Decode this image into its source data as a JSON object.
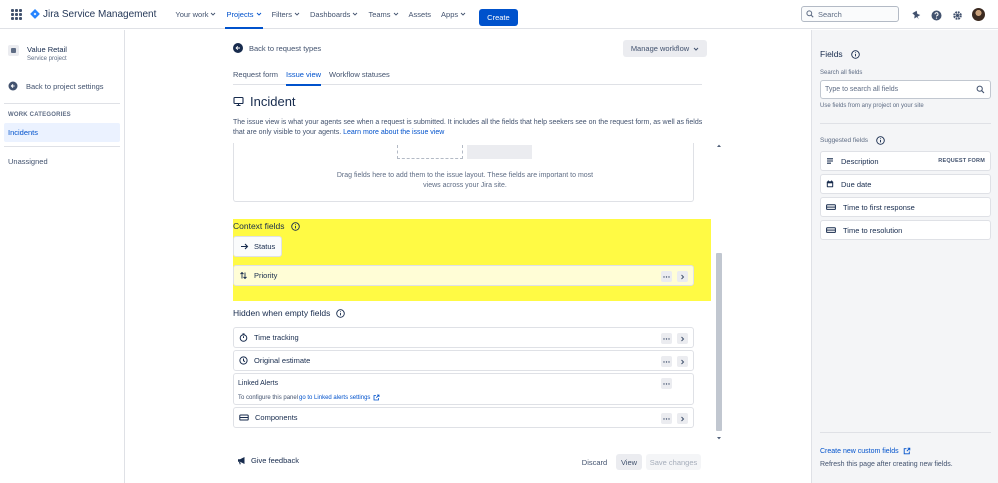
{
  "topnav": {
    "logo_text": "Jira Service Management",
    "items": [
      {
        "label": "Your work",
        "has_menu": true
      },
      {
        "label": "Projects",
        "has_menu": true,
        "active": true
      },
      {
        "label": "Filters",
        "has_menu": true
      },
      {
        "label": "Dashboards",
        "has_menu": true
      },
      {
        "label": "Teams",
        "has_menu": true
      },
      {
        "label": "Assets",
        "has_menu": false
      },
      {
        "label": "Apps",
        "has_menu": true
      }
    ],
    "create_label": "Create",
    "search_placeholder": "Search",
    "icons": [
      "notification-icon",
      "help-icon",
      "settings-icon",
      "avatar"
    ]
  },
  "sidebar": {
    "project_name": "Value Retail",
    "project_type": "Service project",
    "back_label": "Back to project settings",
    "heading": "WORK CATEGORIES",
    "items": [
      {
        "label": "Incidents",
        "active": true
      },
      {
        "label": "Unassigned",
        "active": false
      }
    ]
  },
  "main": {
    "back_label": "Back to request types",
    "manage_workflow_label": "Manage workflow",
    "tabs": [
      {
        "label": "Request form",
        "active": false
      },
      {
        "label": "Issue view",
        "active": true
      },
      {
        "label": "Workflow statuses",
        "active": false
      }
    ],
    "title": "Incident",
    "description": "The issue view is what your agents see when a request is submitted. It includes all the fields that help seekers see on the request form, as well as fields that are only visible to your agents.",
    "learn_more_label": "Learn more about the issue view",
    "dropzone_text": "Drag fields here to add them to the issue layout. These fields are important to most views across your Jira site.",
    "context": {
      "title": "Context fields",
      "status_label": "Status",
      "priority_label": "Priority"
    },
    "hidden": {
      "title": "Hidden when empty fields",
      "rows": [
        {
          "label": "Time tracking",
          "icon": "stopwatch-icon"
        },
        {
          "label": "Original estimate",
          "icon": "clock-icon"
        }
      ],
      "linked_alerts": {
        "title": "Linked Alerts",
        "prefix": "To configure this panel",
        "link": "go to Linked alerts settings"
      },
      "components_label": "Components"
    },
    "footer": {
      "feedback_label": "Give feedback",
      "discard_label": "Discard",
      "view_label": "View",
      "save_label": "Save changes"
    },
    "highlight_color": "#fffa44"
  },
  "fields_panel": {
    "title": "Fields",
    "search_label": "Search all fields",
    "search_placeholder": "Type to search all fields",
    "search_hint": "Use fields from any project on your site",
    "suggested_label": "Suggested fields",
    "suggested": [
      {
        "label": "Description",
        "badge": "REQUEST FORM",
        "icon": "text-lines-icon"
      },
      {
        "label": "Due date",
        "badge": "",
        "icon": "calendar-icon"
      },
      {
        "label": "Time to first response",
        "badge": "",
        "icon": "sla-icon"
      },
      {
        "label": "Time to resolution",
        "badge": "",
        "icon": "sla-icon"
      }
    ],
    "create_label": "Create new custom fields",
    "refresh_text": "Refresh this page after creating new fields."
  }
}
